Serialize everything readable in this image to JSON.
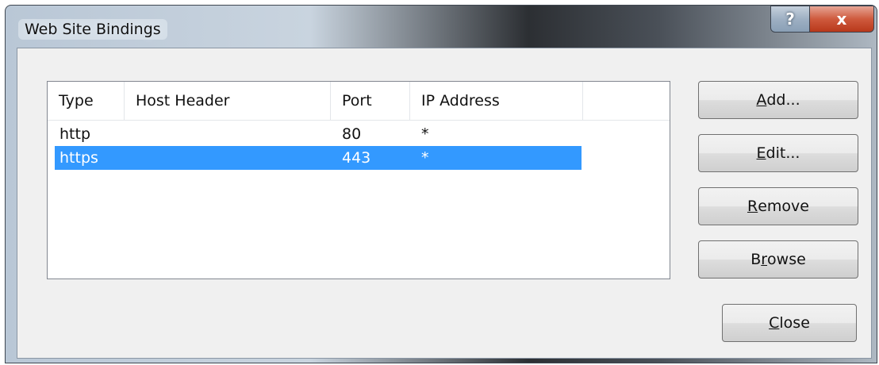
{
  "window": {
    "title": "Web Site Bindings",
    "help_glyph": "?",
    "close_glyph": "x"
  },
  "bindings": {
    "columns": [
      "Type",
      "Host Header",
      "Port",
      "IP Address"
    ],
    "rows": [
      {
        "type": "http",
        "host_header": "",
        "port": "80",
        "ip_address": "*",
        "selected": false
      },
      {
        "type": "https",
        "host_header": "",
        "port": "443",
        "ip_address": "*",
        "selected": true
      }
    ]
  },
  "buttons": {
    "add": {
      "mnemonic": "A",
      "rest": "dd..."
    },
    "edit": {
      "mnemonic": "E",
      "rest": "dit..."
    },
    "remove": {
      "mnemonic": "R",
      "rest": "emove"
    },
    "browse": {
      "pre": "B",
      "mnemonic": "r",
      "rest": "owse"
    },
    "close": {
      "mnemonic": "C",
      "rest": "lose"
    }
  },
  "colors": {
    "selection": "#3399ff",
    "close_button": "#cf5a3d"
  }
}
